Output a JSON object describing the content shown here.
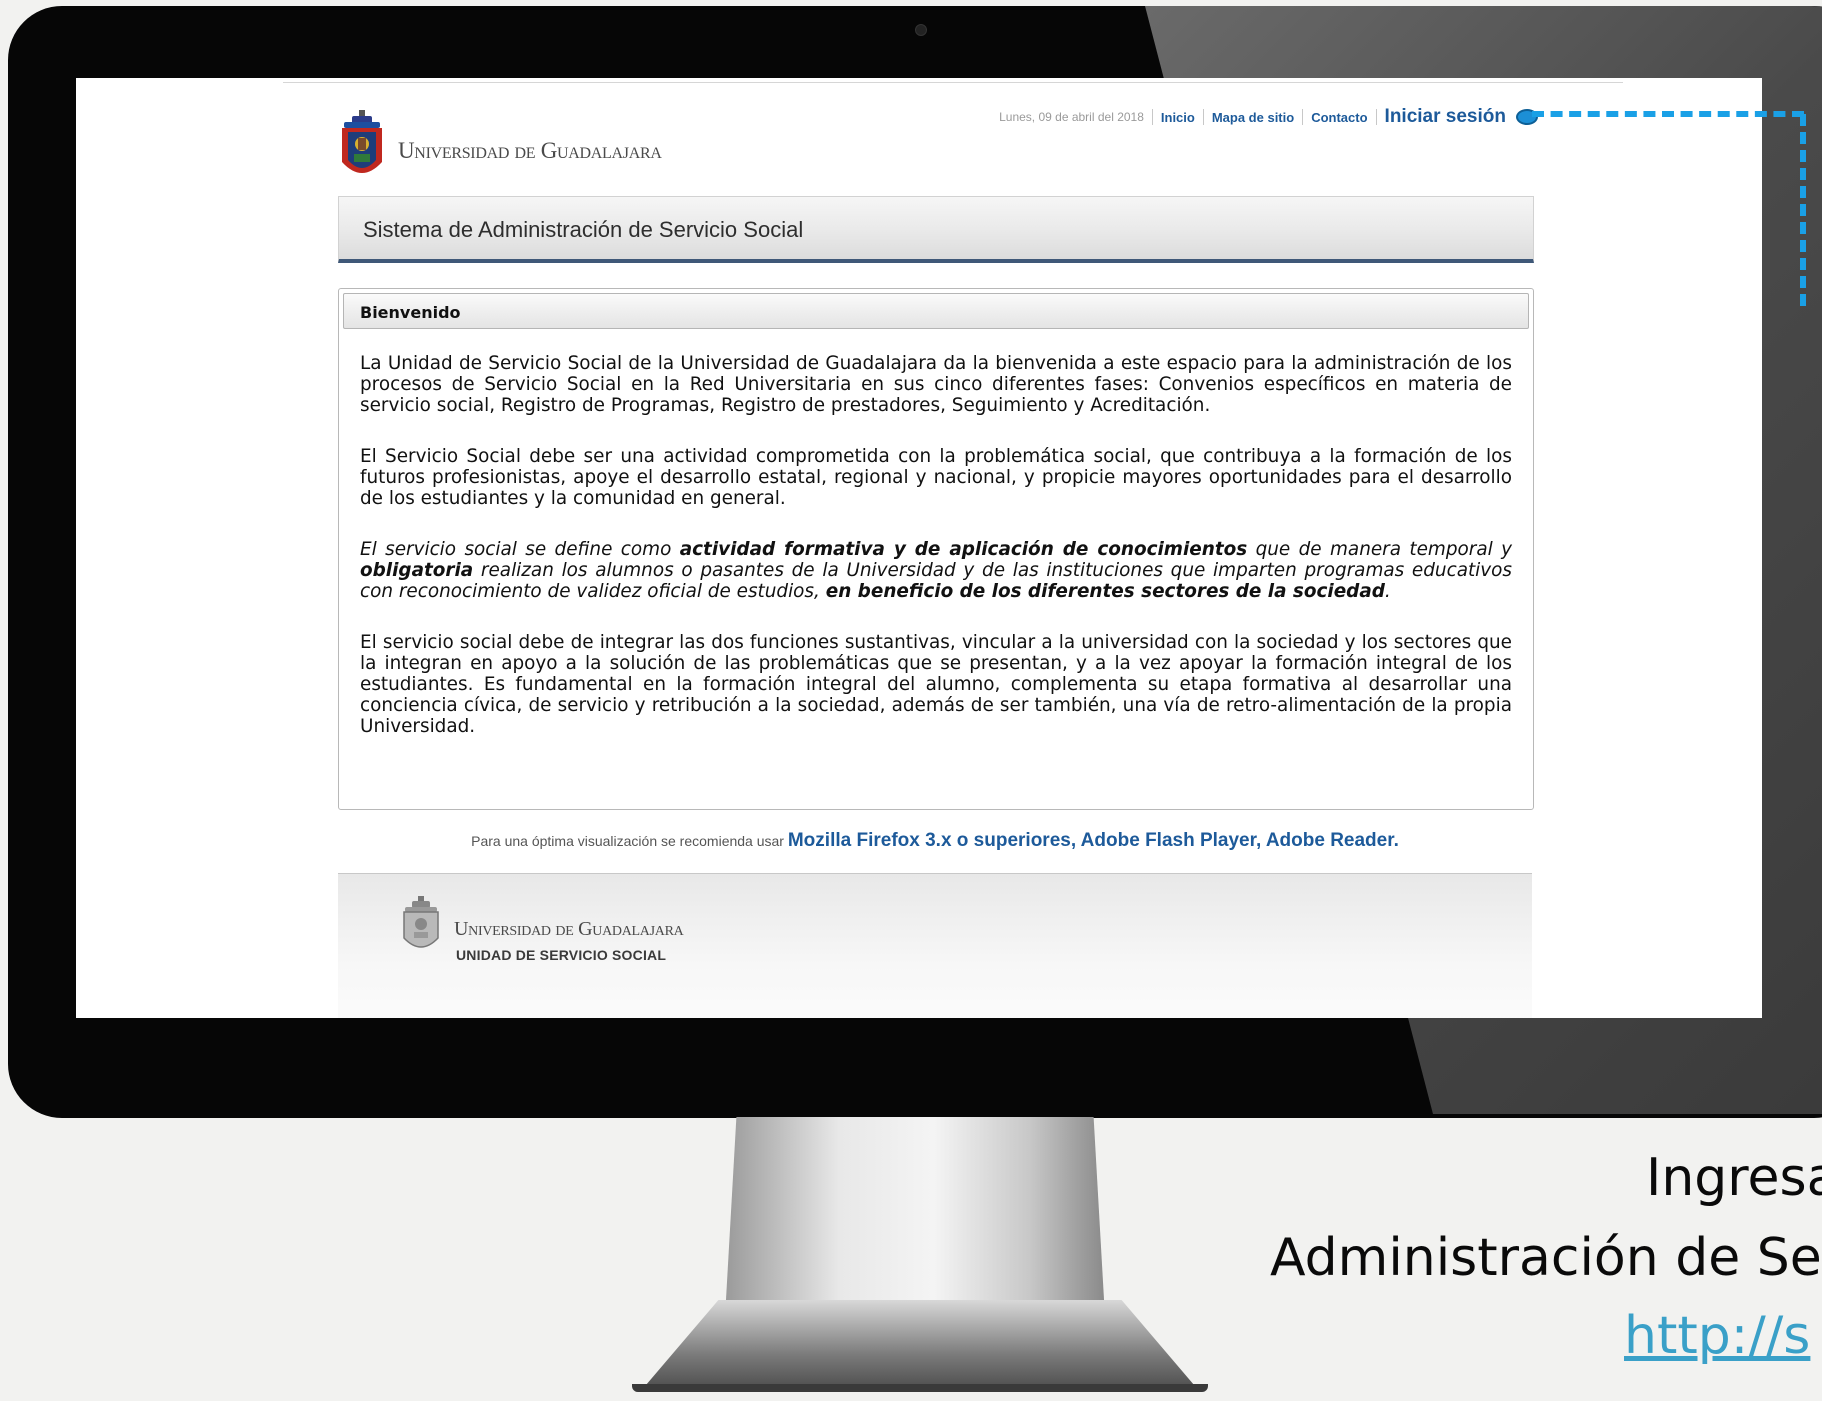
{
  "header": {
    "logo_text": "Universidad de Guadalajara",
    "date": "Lunes, 09 de abril del 2018",
    "nav": [
      "Inicio",
      "Mapa de sitio",
      "Contacto"
    ],
    "login": "Iniciar sesión"
  },
  "title_bar": {
    "title": "Sistema de Administración de Servicio Social"
  },
  "welcome": {
    "heading": "Bienvenido",
    "p1": "La Unidad de Servicio Social de la Universidad de Guadalajara da la bienvenida a este espacio para la administración de los procesos de Servicio Social en la Red Universitaria en sus cinco diferentes fases: Convenios específicos en materia de servicio social, Registro de Programas, Registro de prestadores, Seguimiento y Acreditación.",
    "p2": "El Servicio Social debe ser una actividad comprometida con la problemática social, que contribuya a la formación de los futuros profesionistas, apoye el desarrollo estatal, regional y nacional, y propicie mayores oportunidades para el desarrollo de los estudiantes y la comunidad en general.",
    "p3": {
      "a": "El servicio social se define como ",
      "b": "actividad formativa y de aplicación de conocimientos",
      "c": " que de manera temporal y ",
      "d": "obligatoria",
      "e": " realizan los alumnos o pasantes de la Universidad y de las instituciones que imparten programas educativos con reconocimiento de validez oficial de estudios, ",
      "f": "en beneficio de los diferentes sectores de la sociedad",
      "g": "."
    },
    "p4": "El servicio social debe de integrar las dos funciones sustantivas, vincular a la universidad con la sociedad y los sectores que la integran en apoyo a la solución de las problemáticas que se presentan, y a la vez apoyar la formación integral de los estudiantes. Es fundamental en la formación integral del alumno, complementa su etapa formativa al desarrollar una conciencia cívica, de servicio y retribución a la sociedad, además de ser también, una vía de retro-alimentación de la propia Universidad."
  },
  "recommendation": {
    "prefix": "Para una óptima visualización se recomienda usar ",
    "software": "Mozilla Firefox 3.x o superiores, Adobe Flash Player, Adobe Reader."
  },
  "footer": {
    "name": "Universidad de Guadalajara",
    "unit": "UNIDAD DE SERVICIO SOCIAL"
  },
  "caption": {
    "line1": "Ingresa",
    "line2": "Administración de Se",
    "link": "http://s"
  },
  "colors": {
    "link": "#1d5a9a",
    "title_bar_border": "#3f5878",
    "connector": "#1aa0e6",
    "caption_link": "#3aa0c8"
  }
}
